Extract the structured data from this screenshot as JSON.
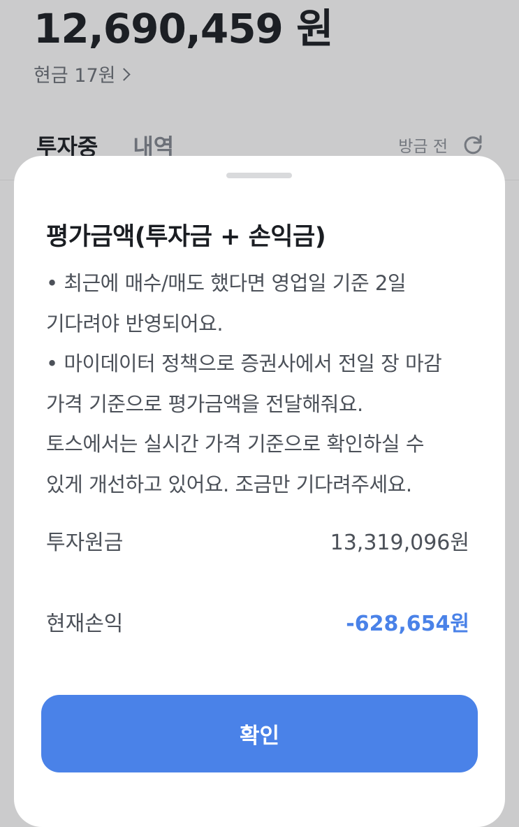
{
  "background": {
    "total_amount": "12,690,459 원",
    "cash_label": "현금 17원",
    "tabs": [
      {
        "label": "투자중",
        "active": true
      },
      {
        "label": "내역",
        "active": false
      }
    ],
    "refresh_label": "방금 전"
  },
  "sheet": {
    "title": "평가금액(투자금 + 손익금)",
    "notes": [
      "• 최근에 매수/매도 했다면 영업일 기준 2일",
      "기다려야 반영되어요.",
      "• 마이데이터 정책으로 증권사에서 전일 장 마감",
      "가격 기준으로 평가금액을 전달해줘요.",
      "토스에서는 실시간 가격 기준으로 확인하실 수",
      "있게 개선하고 있어요. 조금만 기다려주세요."
    ],
    "rows": [
      {
        "label": "투자원금",
        "value": "13,319,096원"
      },
      {
        "label": "현재손익",
        "value": "-628,654원"
      }
    ],
    "confirm_label": "확인"
  },
  "colors": {
    "accent": "#4a82e8",
    "overlay_background": "#cbcbcc",
    "sheet_background": "#ffffff"
  }
}
